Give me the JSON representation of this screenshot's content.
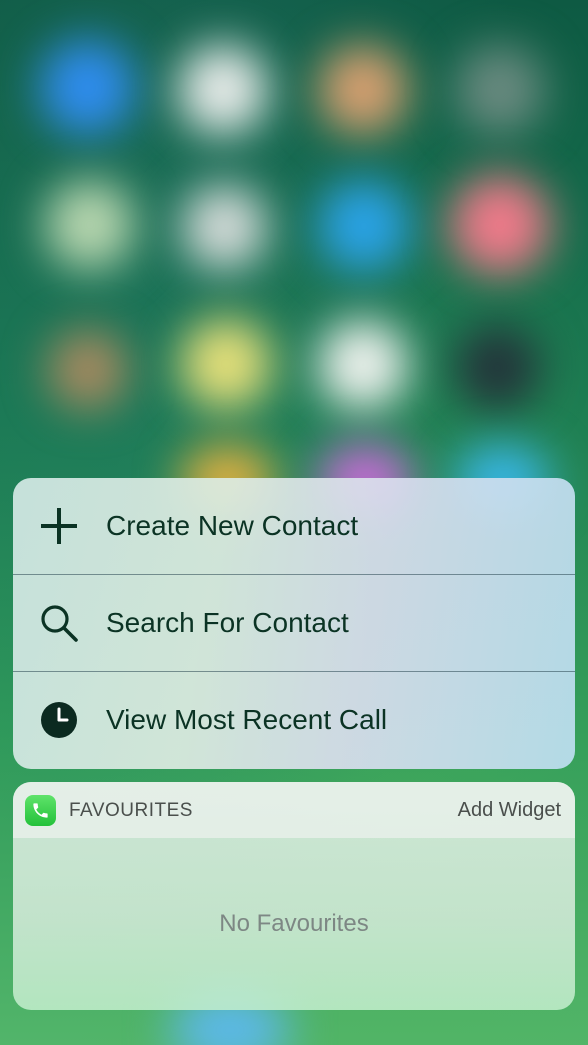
{
  "quick_actions": {
    "items": [
      {
        "label": "Create New Contact",
        "icon": "plus-icon"
      },
      {
        "label": "Search For Contact",
        "icon": "magnifier-icon"
      },
      {
        "label": "View Most Recent Call",
        "icon": "clock-icon"
      }
    ]
  },
  "favourites_widget": {
    "title": "FAVOURITES",
    "add_widget_label": "Add Widget",
    "empty_message": "No Favourites",
    "app_icon": "phone-app-icon"
  },
  "colors": {
    "label_text": "#0b3324",
    "widget_text": "#4a4f4c",
    "empty_text": "#7d8784",
    "phone_green": "#23c13a"
  }
}
